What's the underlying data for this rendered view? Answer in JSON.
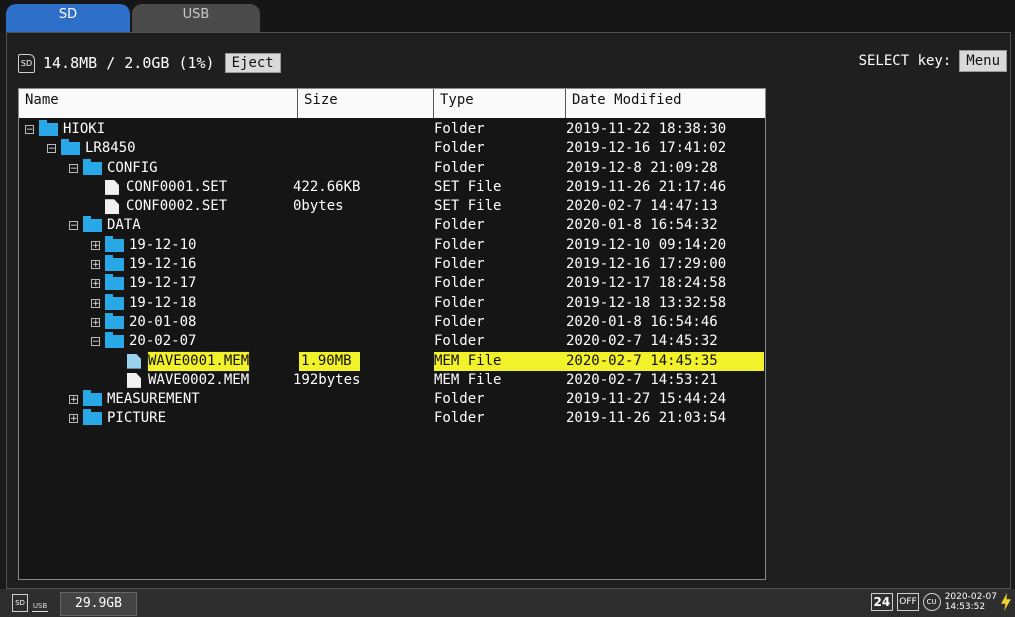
{
  "tabs": [
    {
      "label": "SD",
      "active": true
    },
    {
      "label": "USB",
      "active": false
    }
  ],
  "storage": {
    "usage": "14.8MB / 2.0GB (1%)",
    "eject_label": "Eject",
    "select_key_label": "SELECT key:",
    "menu_label": "Menu"
  },
  "columns": {
    "name": "Name",
    "size": "Size",
    "type": "Type",
    "date": "Date Modified"
  },
  "rows": [
    {
      "level": 0,
      "kind": "folder",
      "expander": "−",
      "name": "HIOKI",
      "size": "",
      "type": "Folder",
      "date": "2019-11-22 18:38:30"
    },
    {
      "level": 1,
      "kind": "folder",
      "expander": "−",
      "name": "LR8450",
      "size": "",
      "type": "Folder",
      "date": "2019-12-16 17:41:02"
    },
    {
      "level": 2,
      "kind": "folder",
      "expander": "−",
      "name": "CONFIG",
      "size": "",
      "type": "Folder",
      "date": "2019-12-8 21:09:28"
    },
    {
      "level": 3,
      "kind": "file",
      "expander": "",
      "name": "CONF0001.SET",
      "size": "422.66KB",
      "type": "SET File",
      "date": "2019-11-26 21:17:46"
    },
    {
      "level": 3,
      "kind": "file",
      "expander": "",
      "name": "CONF0002.SET",
      "size": "0bytes",
      "type": "SET File",
      "date": "2020-02-7 14:47:13"
    },
    {
      "level": 2,
      "kind": "folder",
      "expander": "−",
      "name": "DATA",
      "size": "",
      "type": "Folder",
      "date": "2020-01-8 16:54:32"
    },
    {
      "level": 3,
      "kind": "folder",
      "expander": "+",
      "name": "19-12-10",
      "size": "",
      "type": "Folder",
      "date": "2019-12-10 09:14:20"
    },
    {
      "level": 3,
      "kind": "folder",
      "expander": "+",
      "name": "19-12-16",
      "size": "",
      "type": "Folder",
      "date": "2019-12-16 17:29:00"
    },
    {
      "level": 3,
      "kind": "folder",
      "expander": "+",
      "name": "19-12-17",
      "size": "",
      "type": "Folder",
      "date": "2019-12-17 18:24:58"
    },
    {
      "level": 3,
      "kind": "folder",
      "expander": "+",
      "name": "19-12-18",
      "size": "",
      "type": "Folder",
      "date": "2019-12-18 13:32:58"
    },
    {
      "level": 3,
      "kind": "folder",
      "expander": "+",
      "name": "20-01-08",
      "size": "",
      "type": "Folder",
      "date": "2020-01-8 16:54:46"
    },
    {
      "level": 3,
      "kind": "folder",
      "expander": "−",
      "name": "20-02-07",
      "size": "",
      "type": "Folder",
      "date": "2020-02-7 14:45:32"
    },
    {
      "level": 4,
      "kind": "file",
      "expander": "",
      "name": "WAVE0001.MEM",
      "size": "1.90MB",
      "type": "MEM File",
      "date": "2020-02-7 14:45:35",
      "selected": true
    },
    {
      "level": 4,
      "kind": "file",
      "expander": "",
      "name": "WAVE0002.MEM",
      "size": "192bytes",
      "type": "MEM File",
      "date": "2020-02-7 14:53:21"
    },
    {
      "level": 2,
      "kind": "folder",
      "expander": "+",
      "name": "MEASUREMENT",
      "size": "",
      "type": "Folder",
      "date": "2019-11-27 15:44:24"
    },
    {
      "level": 2,
      "kind": "folder",
      "expander": "+",
      "name": "PICTURE",
      "size": "",
      "type": "Folder",
      "date": "2019-11-26 21:03:54"
    }
  ],
  "statusbar": {
    "sd_icon": "SD",
    "usb_icon": "USB",
    "free_space": "29.9GB",
    "interval_badge": "24",
    "off_badge": "OFF",
    "circle_badge": "CU",
    "date": "2020-02-07",
    "time": "14:53:52"
  },
  "colors": {
    "active_tab": "#2d6ec8",
    "selection": "#f2f22a",
    "folder": "#29a8e8"
  }
}
